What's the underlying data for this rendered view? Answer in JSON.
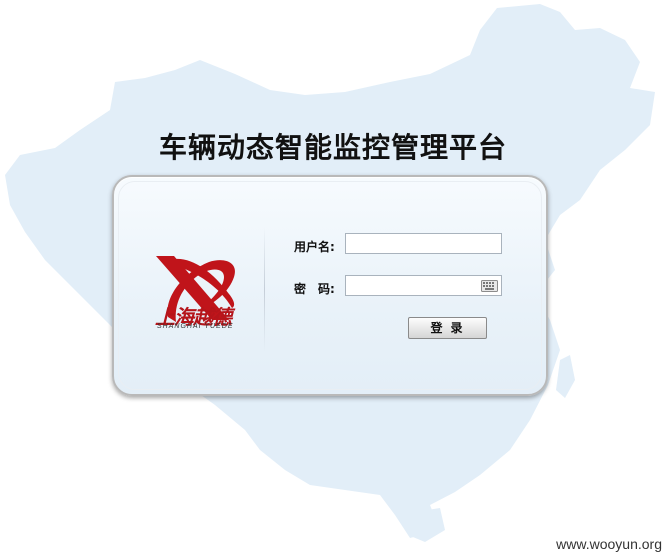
{
  "page": {
    "title": "车辆动态智能监控管理平台",
    "watermark": "www.wooyun.org"
  },
  "logo": {
    "name_cn": "上海越德",
    "name_en": "SHANGHAI YUEDE",
    "brand_color": "#c0141a"
  },
  "form": {
    "username_label": "用户名:",
    "username_value": "",
    "password_label": "密　码:",
    "password_value": "",
    "login_button": "登录",
    "keyboard_icon": "keyboard-icon"
  },
  "colors": {
    "map_fill": "#e2eef8",
    "panel_border": "#b9b9b9"
  }
}
